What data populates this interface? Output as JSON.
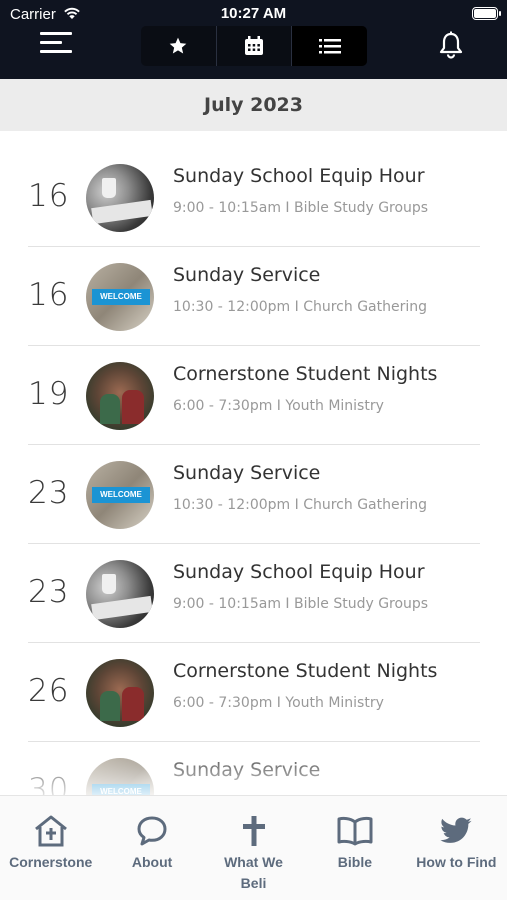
{
  "status_bar": {
    "carrier": "Carrier",
    "time": "10:27 AM"
  },
  "header": {
    "menu_icon": "hamburger-icon",
    "segments": [
      {
        "icon": "star-icon",
        "active": false
      },
      {
        "icon": "calendar-icon",
        "active": false
      },
      {
        "icon": "list-icon",
        "active": true
      }
    ],
    "notifications_icon": "bell-icon"
  },
  "month": {
    "title": "July 2023"
  },
  "events": [
    {
      "day": "16",
      "title": "Sunday School Equip Hour",
      "meta": "9:00  -  10:15am  I  Bible Study Groups",
      "thumb": "school"
    },
    {
      "day": "16",
      "title": "Sunday Service",
      "meta": "10:30  -  12:00pm  I  Church Gathering",
      "thumb": "welcome"
    },
    {
      "day": "19",
      "title": "Cornerstone Student Nights",
      "meta": "6:00  -  7:30pm  I  Youth Ministry",
      "thumb": "students"
    },
    {
      "day": "23",
      "title": "Sunday Service",
      "meta": "10:30  -  12:00pm  I  Church Gathering",
      "thumb": "welcome"
    },
    {
      "day": "23",
      "title": "Sunday School Equip Hour",
      "meta": "9:00  -  10:15am  I  Bible Study Groups",
      "thumb": "school"
    },
    {
      "day": "26",
      "title": "Cornerstone Student Nights",
      "meta": "6:00  -  7:30pm  I  Youth Ministry",
      "thumb": "students"
    },
    {
      "day": "30",
      "title": "Sunday Service",
      "meta": "",
      "thumb": "welcome"
    }
  ],
  "welcome_banner_text": "WELCOME",
  "tabbar": {
    "tabs": [
      {
        "label": "Cornerstone",
        "icon": "home-icon"
      },
      {
        "label": "About",
        "icon": "chat-bubble-icon"
      },
      {
        "label": "What We\nBeli",
        "icon": "cross-icon"
      },
      {
        "label": "Bible",
        "icon": "open-book-icon"
      },
      {
        "label": "How to Find",
        "icon": "twitter-bird-icon"
      }
    ]
  },
  "colors": {
    "header_bg": "#0f1420",
    "tab_label": "#5d6b7d",
    "welcome_blue": "#1b94d4"
  }
}
